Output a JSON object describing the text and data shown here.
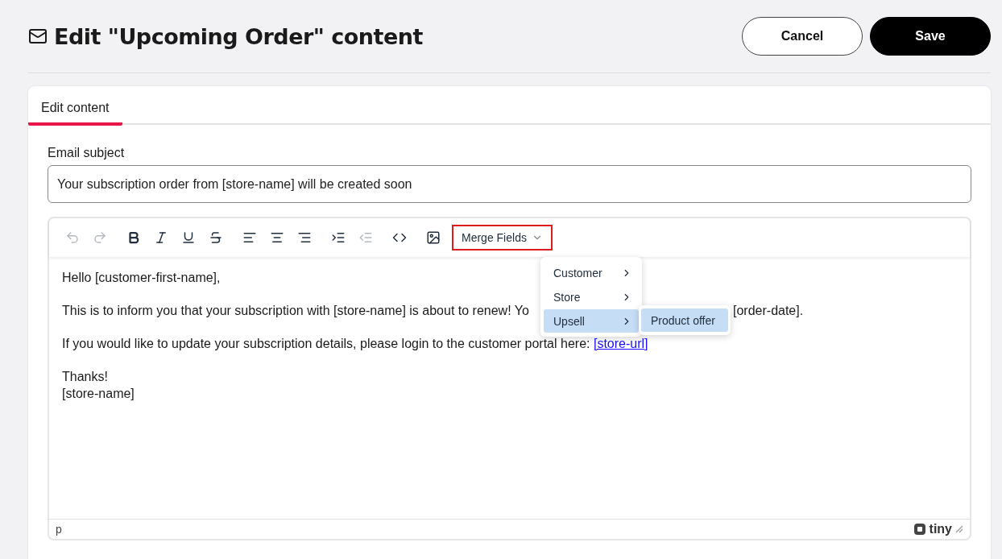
{
  "title": "Edit \"Upcoming Order\" content",
  "buttons": [
    {
      "label": "Cancel",
      "kind": "secondary"
    },
    {
      "label": "Save",
      "kind": "primary"
    }
  ],
  "tabs": [
    {
      "label": "Edit content",
      "selected": true
    }
  ],
  "subject": {
    "label": "Email subject",
    "value": "Your subscription order from [store-name] will be created soon"
  },
  "toolbar": [
    {
      "kind": "undo",
      "disabled": true
    },
    {
      "kind": "redo",
      "disabled": true
    },
    {
      "kind": "sep"
    },
    {
      "kind": "bold",
      "disabled": false
    },
    {
      "kind": "italic",
      "disabled": false
    },
    {
      "kind": "underline",
      "disabled": false
    },
    {
      "kind": "strike",
      "disabled": false
    },
    {
      "kind": "sep"
    },
    {
      "kind": "align-left",
      "disabled": false
    },
    {
      "kind": "align-center",
      "disabled": false
    },
    {
      "kind": "align-right",
      "disabled": false
    },
    {
      "kind": "sep"
    },
    {
      "kind": "indent",
      "disabled": false
    },
    {
      "kind": "outdent",
      "disabled": true
    },
    {
      "kind": "sep"
    },
    {
      "kind": "code",
      "disabled": false
    },
    {
      "kind": "sep"
    },
    {
      "kind": "image",
      "disabled": false
    }
  ],
  "merge_fields": {
    "label": "Merge Fields",
    "highlighted": true,
    "items": [
      {
        "label": "Customer",
        "selected": false
      },
      {
        "label": "Store",
        "selected": false
      },
      {
        "label": "Upsell",
        "selected": true
      }
    ],
    "submenu": [
      {
        "label": "Product offer",
        "selected": true
      }
    ]
  },
  "body": [
    {
      "kind": "line",
      "text": "Hello [customer-first-name],"
    },
    {
      "kind": "covered",
      "before": "This is to inform you that your subscription with [store-name] is about to renew! Yo",
      "after": "[order-date]."
    },
    {
      "kind": "link",
      "text": "If you would like to update your subscription details, please login to the customer portal here: ",
      "link": "[store-url]"
    },
    {
      "kind": "lines",
      "lines": [
        "Thanks!",
        "[store-name]"
      ]
    }
  ],
  "status_bar": {
    "path": "p",
    "brand": "tiny"
  }
}
